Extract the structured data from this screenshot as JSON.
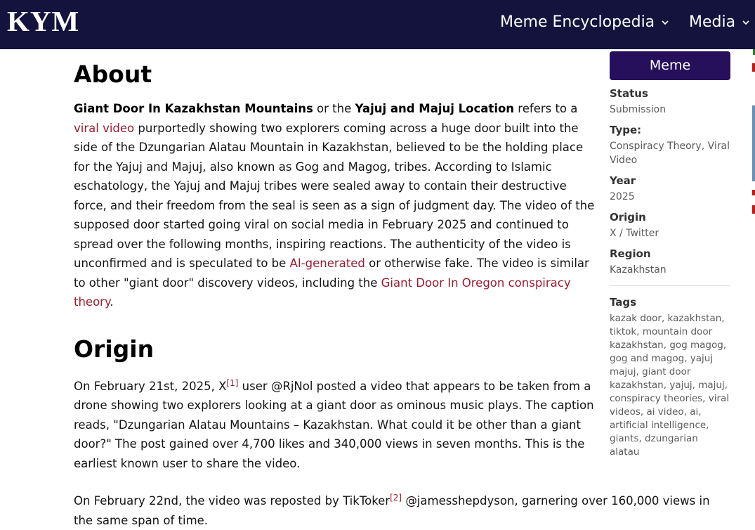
{
  "header": {
    "logo": "KYM",
    "nav": [
      {
        "label": "Meme Encyclopedia",
        "icon": "chevron-down-icon"
      },
      {
        "label": "Media",
        "icon": "chevron-down-icon"
      }
    ],
    "background": "#13133d"
  },
  "about": {
    "heading": "About",
    "bold_1": "Giant Door In Kazakhstan Mountains",
    "text_1": " or the ",
    "bold_2": "Yajuj and Majuj Location",
    "text_2": " refers to a ",
    "link_1": "viral video",
    "text_3": " purportedly showing two explorers coming across a huge door built into the side of the Dzungarian Alatau Mountain in Kazakhstan, believed to be the holding place for the Yajuj and Majuj, also known as Gog and Magog, tribes. According to Islamic eschatology, the Yajuj and Majuj tribes were sealed away to contain their destructive force, and their freedom from the seal is seen as a sign of judgment day. The video of the supposed door started going viral on social media in February 2025 and continued to spread over the following months, inspiring reactions. The authenticity of the video is unconfirmed and is speculated to be ",
    "link_2": "AI-generated",
    "text_4": " or otherwise fake. The video is similar to other \"giant door\" discovery videos, including the ",
    "link_3": "Giant Door In Oregon conspiracy theory",
    "text_5": "."
  },
  "origin": {
    "heading": "Origin",
    "p1_a": "On February 21st, 2025, X",
    "p1_ref": "[1]",
    "p1_b": " user @RjNol posted a video that appears to be taken from a drone showing two explorers looking at a giant door as ominous music plays. The caption reads, \"Dzungarian Alatau Mountains – Kazakhstan. What could it be other than a giant door?\" The post gained over 4,700 likes and 340,000 views in seven months. This is the earliest known user to share the video.",
    "p2_a": "On February 22nd, the video was reposted by TikToker",
    "p2_ref": "[2]",
    "p2_b": " @jamesshepdyson, garnering over 160,000 views in the same span of time."
  },
  "sidebar": {
    "category_button": "Meme",
    "fields": [
      {
        "label": "Status",
        "value": "Submission"
      },
      {
        "label": "Type:",
        "value": "Conspiracy Theory, Viral Video"
      },
      {
        "label": "Year",
        "value": "2025"
      },
      {
        "label": "Origin",
        "value": "X / Twitter"
      },
      {
        "label": "Region",
        "value": "Kazakhstan"
      }
    ],
    "tags_label": "Tags",
    "tags": "kazak door, kazakhstan, tiktok, mountain door kazakhstan, gog magog, gog and magog, yajuj majuj, giant door kazakhstan, yajuj, majuj, conspiracy theories, viral videos, ai video, ai, artificial intelligence, giants, dzungarian alatau"
  },
  "colors": {
    "link": "#9b1b30",
    "button": "#26105c"
  }
}
